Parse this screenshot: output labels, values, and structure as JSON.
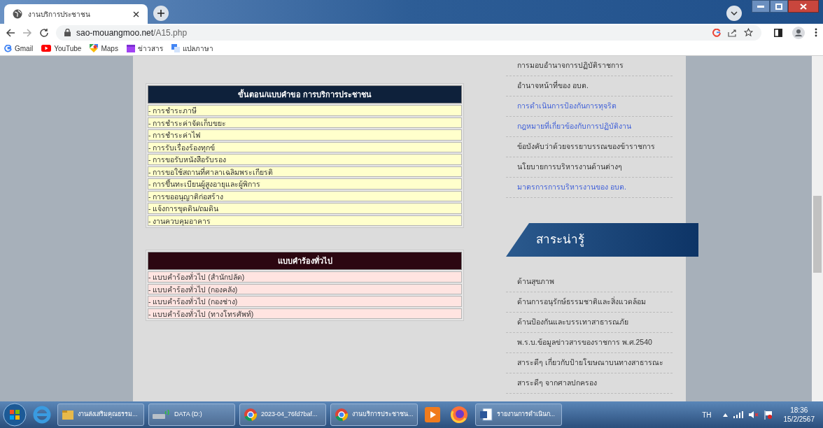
{
  "browser": {
    "tab": {
      "title": "งานบริการประชาชน",
      "selected": true
    },
    "url_host": "sao-mouangmoo.net",
    "url_path": "/A15.php",
    "bookmarks": [
      "Gmail",
      "YouTube",
      "Maps",
      "ข่าวสาร",
      "แปลภาษา"
    ]
  },
  "tables": [
    {
      "title": "ขั้นตอน/แบบคำขอ การบริการประชาชน",
      "kind": "service",
      "rows": [
        "- การชำระภาษี",
        "- การชำระค่าจัดเก็บขยะ",
        "- การชำระค่าไฟ",
        "- การรับเรื่องร้องทุกข์",
        "- การขอรับหนังสือรับรอง",
        "- การขอใช้สถานที่ศาลาเฉลิมพระเกียรติ",
        "- การขึ้นทะเบียนผู้สูงอายุและผู้พิการ",
        "- การขออนุญาติก่อสร้าง",
        "- แจ้งการขุดดิน/ถมดิน",
        "- งานควบคุมอาคาร"
      ]
    },
    {
      "title": "แบบคำร้องทั่วไป",
      "kind": "form",
      "rows": [
        "- แบบคำร้องทั่วไป (สำนักปลัด)",
        "- แบบคำร้องทั่วไป (กองคลัง)",
        "- แบบคำร้องทั่วไป (กองช่าง)",
        "- แบบคำร้องทั่วไป (ทางโทรศัพท์)"
      ]
    }
  ],
  "sidebar": {
    "links": [
      {
        "label": "การมอบอำนาจการปฏิบัติราชการ",
        "highlighted": false
      },
      {
        "label": "อำนาจหน้าที่ของ อบต.",
        "highlighted": false
      },
      {
        "label": "การดำเนินการป้องกันการทุจริต",
        "highlighted": true
      },
      {
        "label": "กฎหมายที่เกี่ยวข้องกับการปฏิบัติงาน",
        "highlighted": true
      },
      {
        "label": "ข้อบังคับว่าด้วยจรรยาบรรณของข้าราชการ",
        "highlighted": false
      },
      {
        "label": "นโยบายการบริหารงานด้านต่างๆ",
        "highlighted": false
      },
      {
        "label": "มาตรการการบริหารงานของ อบต.",
        "highlighted": true
      }
    ],
    "section_title": "สาระน่ารู้",
    "section_links": [
      "ด้านสุขภาพ",
      "ด้านการอนุรักษ์ธรรมชาติและสิ่งแวดล้อม",
      "ด้านป้องกันและบรรเทาสาธารณภัย",
      "พ.ร.บ.ข้อมูลข่าวสารของราชการ พ.ศ.2540",
      "สาระดีๆ เกี่ยวกับป้ายโฆษณาบนทางสาธารณะ",
      "สาระดีๆ จากศาลปกครอง"
    ]
  },
  "taskbar": {
    "items": [
      {
        "label": "งานส่งเสริมคุณธรรม...",
        "kind": "folder"
      },
      {
        "label": "DATA (D:)",
        "kind": "drive"
      },
      {
        "label": "2023-04_76fd7baf...",
        "kind": "chrome"
      },
      {
        "label": "งานบริการประชาชน...",
        "kind": "chrome"
      },
      {
        "label": "รายงานการดำเนินก...",
        "kind": "word"
      }
    ],
    "language": "TH",
    "time": "18:36",
    "date": "15/2/2567"
  }
}
